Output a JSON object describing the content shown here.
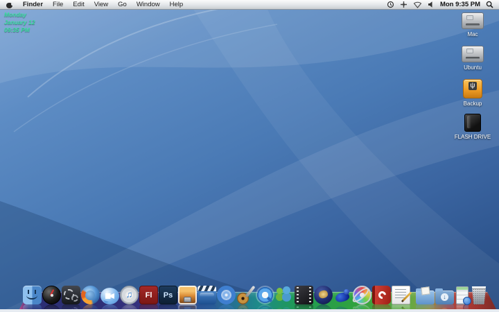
{
  "menubar": {
    "menus": [
      "Finder",
      "File",
      "Edit",
      "View",
      "Go",
      "Window",
      "Help"
    ],
    "clock": "Mon 9:35 PM",
    "status_icons": [
      "time-machine",
      "input-switcher",
      "airport-off",
      "volume"
    ],
    "spotlight": "spotlight"
  },
  "desktop_clock": {
    "weekday": "Monday",
    "date": "January 12",
    "time": "09:35 PM",
    "color": "#3ddfa4"
  },
  "desktop_icons": [
    {
      "label": "Mac",
      "kind": "internal-hard-drive"
    },
    {
      "label": "Ubuntu",
      "kind": "internal-hard-drive"
    },
    {
      "label": "Backup",
      "kind": "external-usb-drive-orange"
    },
    {
      "label": "FLASH DRIVE",
      "kind": "flash-drive-black"
    }
  ],
  "dock": {
    "items": [
      {
        "name": "finder"
      },
      {
        "name": "dashboard"
      },
      {
        "name": "system-preferences"
      },
      {
        "name": "firefox"
      },
      {
        "name": "ichat"
      },
      {
        "name": "itunes"
      },
      {
        "name": "adobe-flash",
        "glyph": "Fl"
      },
      {
        "name": "adobe-photoshop",
        "glyph": "Ps"
      },
      {
        "name": "iphoto"
      },
      {
        "name": "imovie"
      },
      {
        "name": "idvd"
      },
      {
        "name": "garageband"
      },
      {
        "name": "quicktime"
      },
      {
        "name": "msn-messenger"
      },
      {
        "name": "film-strip-app"
      },
      {
        "name": "game-sphere-app"
      },
      {
        "name": "vuze"
      },
      {
        "name": "gyroscope-color-app"
      },
      {
        "name": "red-c-app"
      },
      {
        "name": "textedit"
      },
      {
        "name": "documents-folder"
      },
      {
        "name": "downloads-folder"
      },
      {
        "name": "minimized-window"
      },
      {
        "name": "trash"
      }
    ]
  },
  "colors": {
    "wallpaper_top": "#7ba3d4",
    "wallpaper_bottom": "#24497f",
    "dock_left": "#2c2f74",
    "dock_mid": "#1f9a55",
    "dock_right": "#7c2a26"
  }
}
